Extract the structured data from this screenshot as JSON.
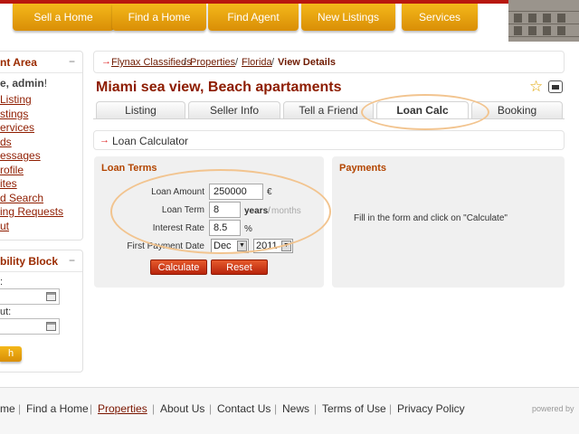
{
  "nav": {
    "items": [
      "Sell a Home",
      "Find a Home",
      "Find Agent",
      "New Listings",
      "Services"
    ]
  },
  "sidebar": {
    "account": {
      "title": "nt Area",
      "toggle": "−",
      "greeting": "e, ",
      "user": "admin",
      "greeting_end": "!",
      "links": [
        "Listing",
        "stings",
        "ervices",
        "ds",
        "essages",
        "rofile",
        "ites",
        "d Search",
        "ing Requests",
        "ut"
      ]
    },
    "availability": {
      "title": "bility Block",
      "toggle": "−",
      "checkin_label": ":",
      "checkout_label": "ut:",
      "button": "h"
    }
  },
  "breadcrumb": {
    "arrow": "→",
    "items": [
      "Flynax Classifieds",
      "Properties",
      "Florida"
    ],
    "separator": "/",
    "current": "View Details"
  },
  "listing": {
    "title": "Miami sea view, Beach apartaments",
    "star": "☆"
  },
  "tabs": [
    "Listing",
    "Seller Info",
    "Tell a Friend",
    "Loan Calc",
    "Booking"
  ],
  "active_tab": "Loan Calc",
  "loan_calc": {
    "arrow": "→",
    "title": "Loan Calculator",
    "terms_header": "Loan Terms",
    "payments_header": "Payments",
    "amount_label": "Loan Amount",
    "amount_value": "250000",
    "currency": "€",
    "term_label": "Loan Term",
    "term_value": "8",
    "term_unit_years": "years",
    "term_unit_sep": "/",
    "term_unit_months": "months",
    "rate_label": "Interest Rate",
    "rate_value": "8.5",
    "rate_unit": "%",
    "first_payment_label": "First Payment Date",
    "month_value": "Dec",
    "year_value": "2011",
    "calculate_button": "Calculate",
    "reset_button": "Reset",
    "payments_hint": "Fill in the form and click on \"Calculate\""
  },
  "footer": {
    "links": [
      "me",
      "Find a Home",
      "Properties",
      "About Us",
      "Contact Us",
      "News",
      "Terms of Use",
      "Privacy Policy"
    ],
    "separator": "|",
    "powered": "powered by"
  },
  "colors": {
    "nav_orange": "#e8a30f",
    "brand_red": "#8d1c00",
    "button_red": "#c8371a",
    "highlight_oval": "#f2c48f"
  }
}
